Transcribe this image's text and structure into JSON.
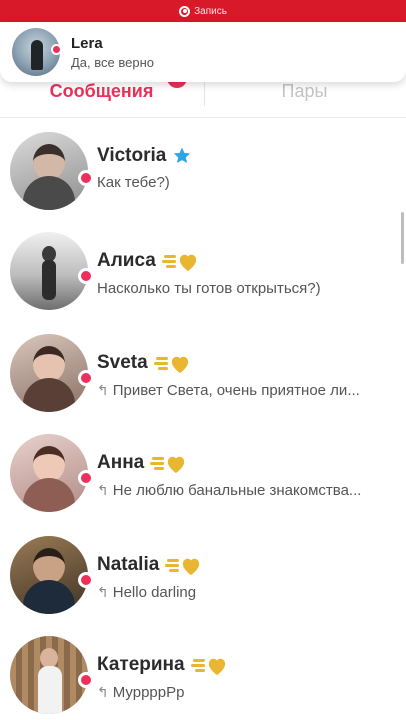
{
  "status_bar": {
    "recording_text": "Запись"
  },
  "notification": {
    "name": "Lera",
    "message": "Да, все верно"
  },
  "tabs": [
    {
      "label": "Сообщения",
      "active": true
    },
    {
      "label": "Пары",
      "active": false
    }
  ],
  "conversations": [
    {
      "name": "Victoria",
      "badge": "verified-star-icon",
      "preview": "Как тебе?)",
      "replied": false
    },
    {
      "name": "Алиса",
      "badge": "gold-heart-icon",
      "preview": "Насколько ты готов открыться?)",
      "replied": false
    },
    {
      "name": "Sveta",
      "badge": "gold-heart-icon",
      "preview": "Привет Света, очень приятное ли...",
      "replied": true
    },
    {
      "name": "Анна",
      "badge": "gold-heart-icon",
      "preview": "Не люблю банальные знакомства...",
      "replied": true
    },
    {
      "name": "Natalia",
      "badge": "gold-heart-icon",
      "preview": "Hello darling",
      "replied": true
    },
    {
      "name": "Катерина",
      "badge": "gold-heart-icon",
      "preview": "МуррррРр",
      "replied": true
    }
  ],
  "colors": {
    "accent": "#ee2f5c",
    "status_bar": "#d8192a",
    "gold": "#e8b630",
    "verified": "#2aa8e6"
  }
}
